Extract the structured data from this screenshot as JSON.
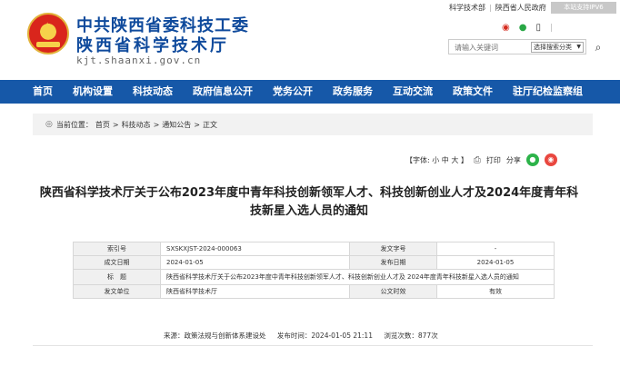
{
  "header": {
    "title_line1": "中共陕西省委科技工委",
    "title_line2": "陕西省科学技术厅",
    "domain": "kjt.shaanxi.gov.cn",
    "top_links": [
      "科学技术部",
      "陕西省人民政府"
    ],
    "top_separator": "|",
    "ipv6_badge": "本站支持IPV6",
    "social_icons": [
      "weibo-icon",
      "wechat-icon",
      "phone-icon"
    ],
    "social_separator": "|",
    "search": {
      "placeholder": "请输入关键词",
      "select_value": "选择搜索分类"
    }
  },
  "nav": {
    "items": [
      "首页",
      "机构设置",
      "科技动态",
      "政府信息公开",
      "党务公开",
      "政务服务",
      "互动交流",
      "政策文件",
      "驻厅纪检监察组"
    ]
  },
  "breadcrumb": {
    "label": "当前位置：",
    "items": [
      "首页",
      "科技动态",
      "通知公告",
      "正文"
    ],
    "separator": ">"
  },
  "toolbar": {
    "font_label": "【字体:",
    "font_small": "小",
    "font_medium": "中",
    "font_large": "大",
    "font_close": "】",
    "print_label": "打印",
    "share_label": "分享"
  },
  "article": {
    "title": "陕西省科学技术厅关于公布2023年度中青年科技创新领军人才、科技创新创业人才及2024年度青年科技新星入选人员的通知"
  },
  "info_table": {
    "row1": {
      "k1": "索引号",
      "v1": "SXSKXJST-2024-000063",
      "k2": "发文字号",
      "v2": "-"
    },
    "row2": {
      "k1": "成文日期",
      "v1": "2024-01-05",
      "k2": "发布日期",
      "v2": "2024-01-05"
    },
    "row3": {
      "k1": "标　题",
      "v1": "陕西省科学技术厅关于公布2023年度中青年科技创新领军人才、科技创新创业人才及 2024年度青年科技新星入选人员的通知"
    },
    "row4": {
      "k1": "发文单位",
      "v1": "陕西省科学技术厅",
      "k2": "公文时效",
      "v2": "有效"
    }
  },
  "meta": {
    "source": "来源：政策法规与创新体系建设处",
    "publish_time": "发布时间：2024-01-05 21:11",
    "views": "浏览次数：877次"
  }
}
